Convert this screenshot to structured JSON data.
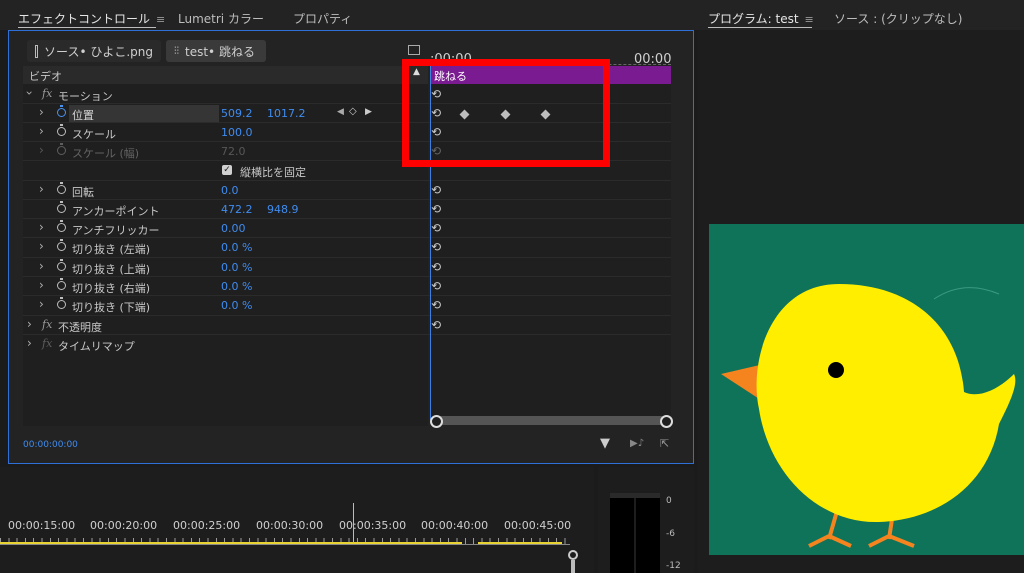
{
  "tabs": {
    "effect_controls": "エフェクトコントロール",
    "lumetri": "Lumetri カラー",
    "properties": "プロパティ",
    "program": "プログラム: test",
    "source": "ソース : (クリップなし)",
    "menu_glyph": "≡"
  },
  "sources": {
    "source_clip": "ソース• ひよこ.png",
    "seq_clip": "test• 跳ねる"
  },
  "timeline_header": {
    "start_time": ":00:00",
    "end_time": "00:00",
    "clip_name": "跳ねる"
  },
  "section_label": "ビデオ",
  "motion": {
    "name": "モーション",
    "position_label": "位置",
    "position_x": "509.2",
    "position_y": "1017.2",
    "scale_label": "スケール",
    "scale_value": "100.0",
    "scale_width_label": "スケール (幅)",
    "scale_width_value": "72.0",
    "uniform_scale_label": "縦横比を固定",
    "rotation_label": "回転",
    "rotation_value": "0.0",
    "anchor_label": "アンカーポイント",
    "anchor_x": "472.2",
    "anchor_y": "948.9",
    "antiflicker_label": "アンチフリッカー",
    "antiflicker_value": "0.00",
    "crop_left_label": "切り抜き (左端)",
    "crop_left_value": "0.0 %",
    "crop_top_label": "切り抜き (上端)",
    "crop_top_value": "0.0 %",
    "crop_right_label": "切り抜き (右端)",
    "crop_right_value": "0.0 %",
    "crop_bottom_label": "切り抜き (下端)",
    "crop_bottom_value": "0.0 %"
  },
  "opacity_label": "不透明度",
  "time_remap_label": "タイムリマップ",
  "current_time": "00:00:00:00",
  "ruler": [
    "00:00:15:00",
    "00:00:20:00",
    "00:00:25:00",
    "00:00:30:00",
    "00:00:35:00",
    "00:00:40:00",
    "00:00:45:00"
  ],
  "meter_labels": [
    "0",
    "-6",
    "-12"
  ],
  "colors": {
    "accent": "#2e6fd8",
    "value_blue": "#3f8cf0",
    "clip_purple": "#7b1b91",
    "highlight_red": "#ff0000",
    "program_bg": "#0f735a",
    "chick_yellow": "#ffee00",
    "beak_orange": "#f5841f"
  }
}
